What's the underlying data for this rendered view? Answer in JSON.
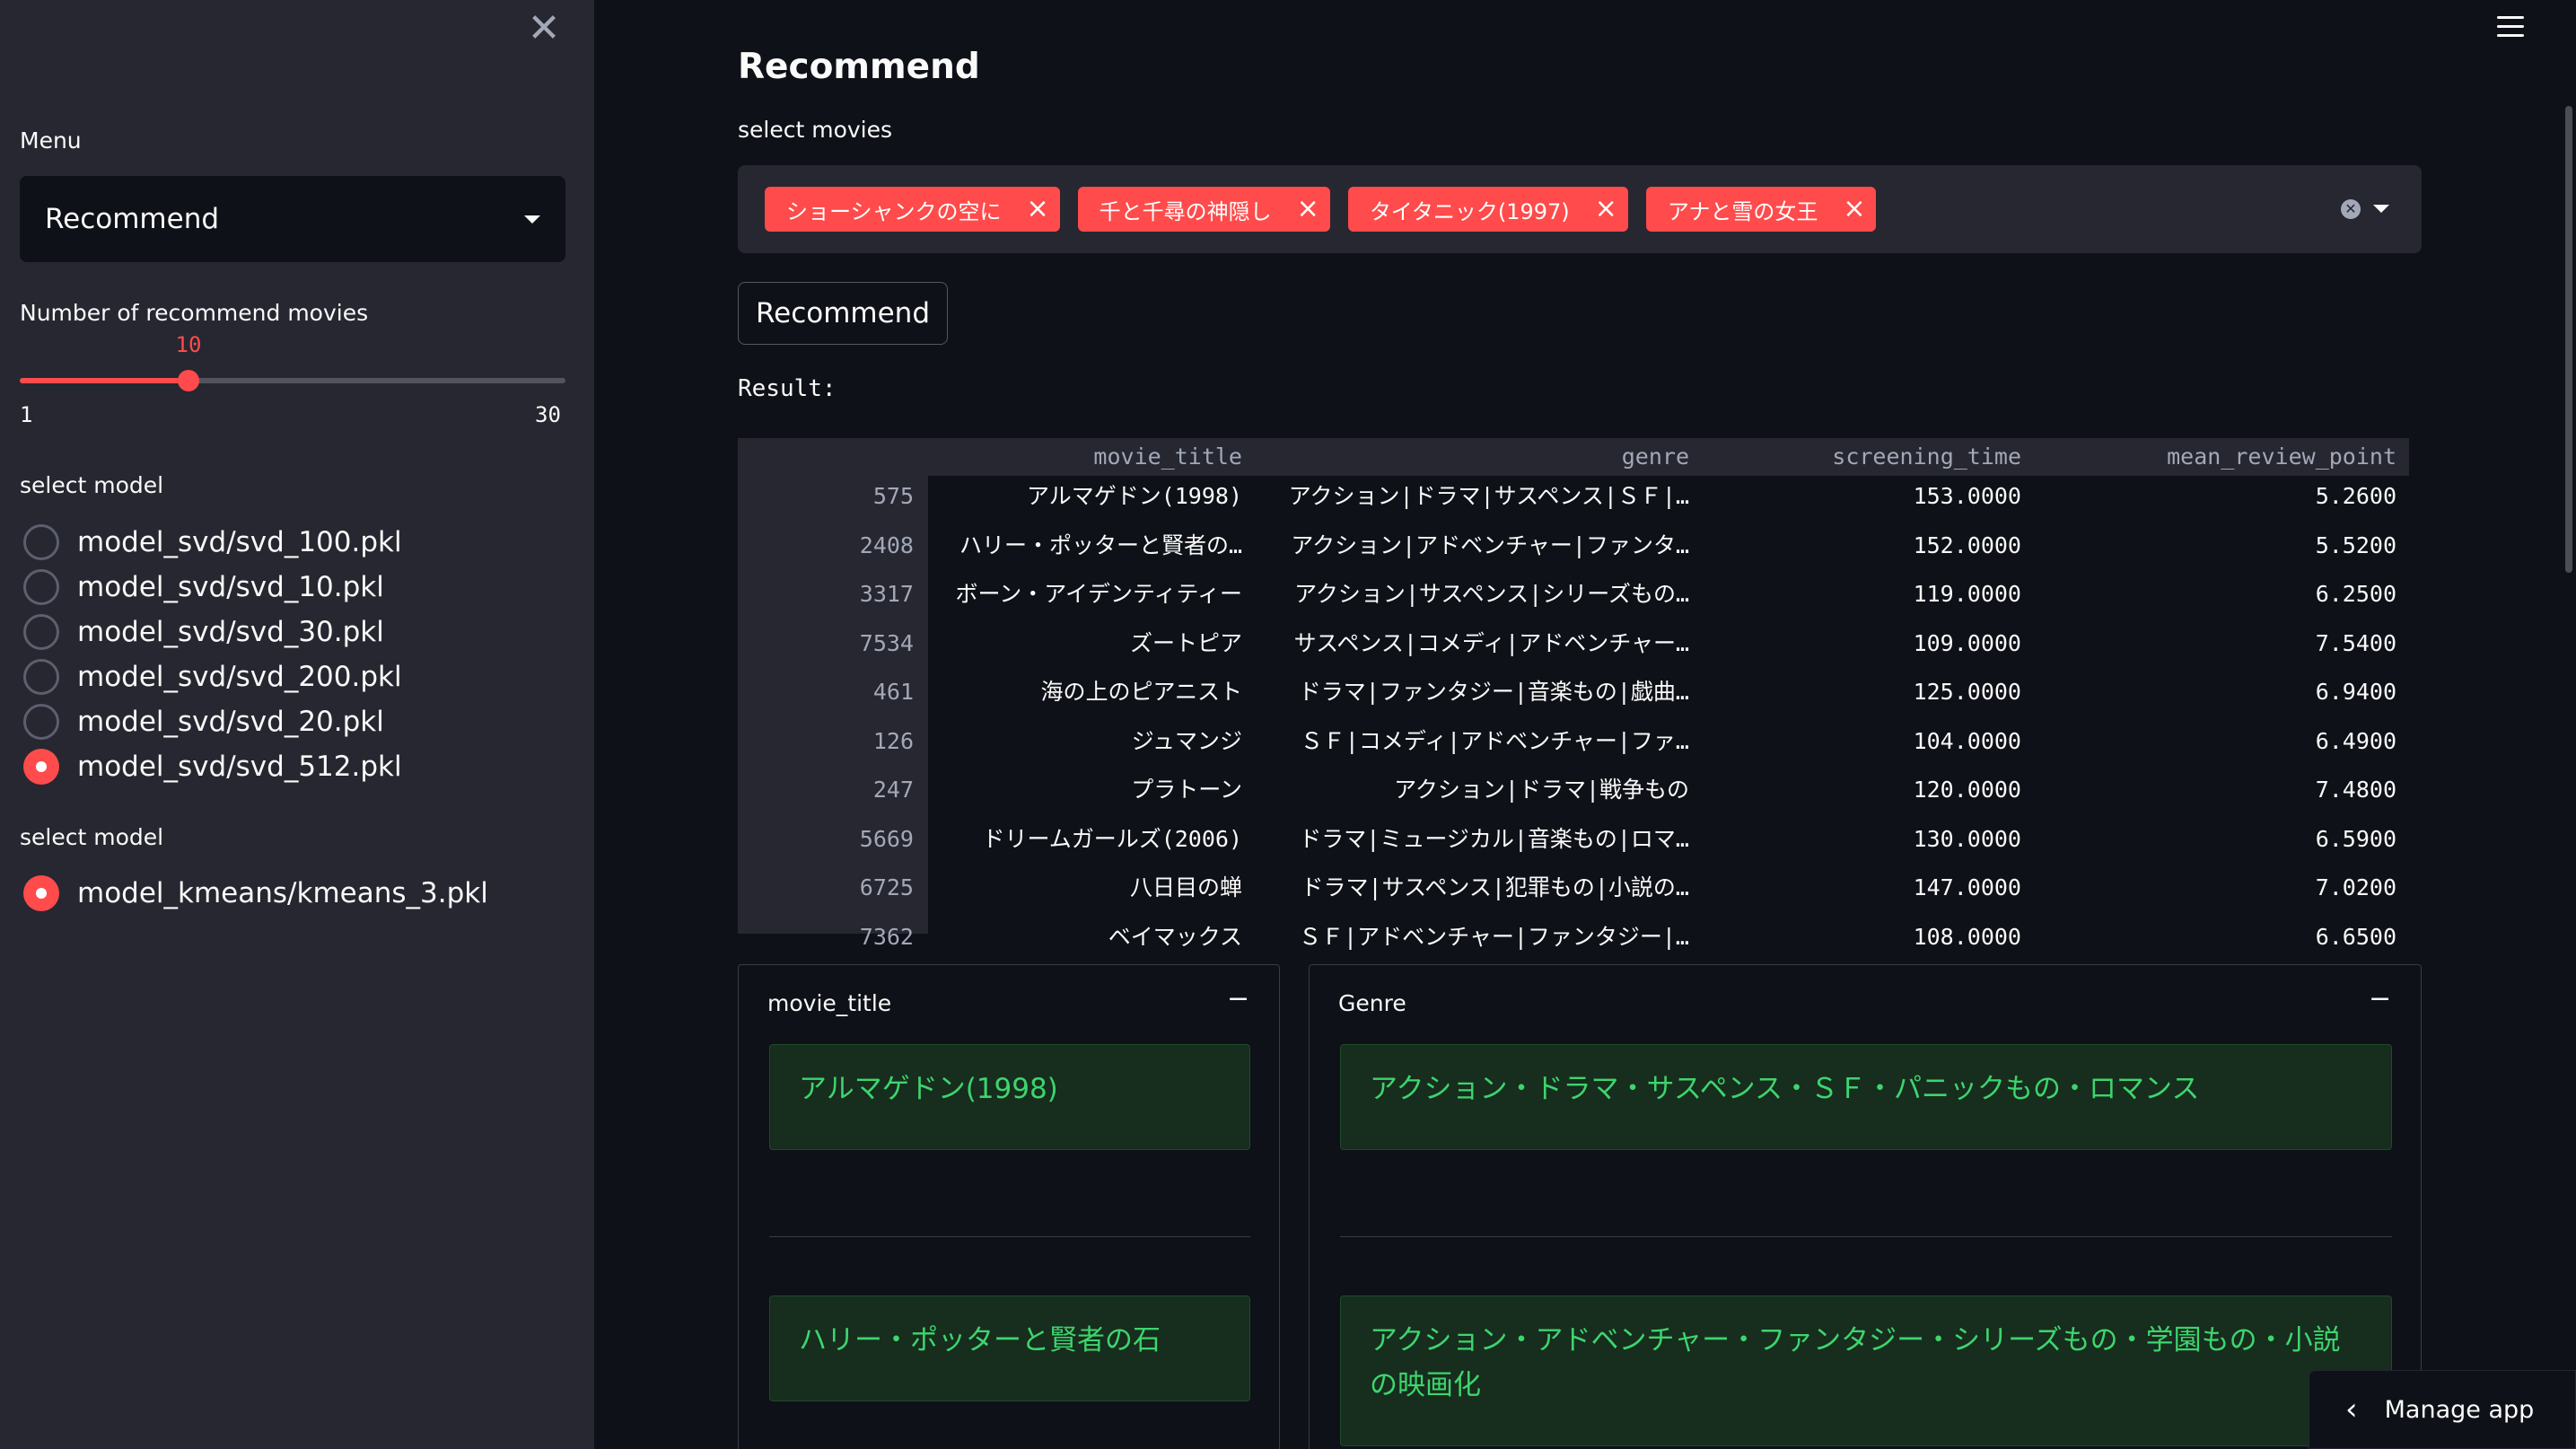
{
  "sidebar": {
    "close_icon": "close-icon",
    "menu_label": "Menu",
    "menu_value": "Recommend",
    "num_label": "Number of recommend movies",
    "slider": {
      "value": "10",
      "min": "1",
      "max": "30",
      "fraction": 0.31
    },
    "model_label_1": "select model",
    "svd_models": [
      {
        "label": "model_svd/svd_100.pkl",
        "checked": false
      },
      {
        "label": "model_svd/svd_10.pkl",
        "checked": false
      },
      {
        "label": "model_svd/svd_30.pkl",
        "checked": false
      },
      {
        "label": "model_svd/svd_200.pkl",
        "checked": false
      },
      {
        "label": "model_svd/svd_20.pkl",
        "checked": false
      },
      {
        "label": "model_svd/svd_512.pkl",
        "checked": true
      }
    ],
    "model_label_2": "select model",
    "kmeans_models": [
      {
        "label": "model_kmeans/kmeans_3.pkl",
        "checked": true
      }
    ]
  },
  "main": {
    "title": "Recommend",
    "select_label": "select movies",
    "chips": [
      "ショーシャンクの空に",
      "千と千尋の神隠し",
      "タイタニック(1997)",
      "アナと雪の女王"
    ],
    "button_label": "Recommend",
    "result_label": "Result:",
    "table": {
      "columns": [
        "movie_title",
        "genre",
        "screening_time",
        "mean_review_point"
      ],
      "rows": [
        [
          "575",
          "アルマゲドン(1998)",
          "アクション|ドラマ|サスペンス|ＳＦ|…",
          "153.0000",
          "5.2600"
        ],
        [
          "2408",
          "ハリー・ポッターと賢者の…",
          "アクション|アドベンチャー|ファンタ…",
          "152.0000",
          "5.5200"
        ],
        [
          "3317",
          "ボーン・アイデンティティー",
          "アクション|サスペンス|シリーズもの…",
          "119.0000",
          "6.2500"
        ],
        [
          "7534",
          "ズートピア",
          "サスペンス|コメディ|アドベンチャー…",
          "109.0000",
          "7.5400"
        ],
        [
          "461",
          "海の上のピアニスト",
          "ドラマ|ファンタジー|音楽もの|戯曲…",
          "125.0000",
          "6.9400"
        ],
        [
          "126",
          "ジュマンジ",
          "ＳＦ|コメディ|アドベンチャー|ファ…",
          "104.0000",
          "6.4900"
        ],
        [
          "247",
          "プラトーン",
          "アクション|ドラマ|戦争もの",
          "120.0000",
          "7.4800"
        ],
        [
          "5669",
          "ドリームガールズ(2006)",
          "ドラマ|ミュージカル|音楽もの|ロマ…",
          "130.0000",
          "6.5900"
        ],
        [
          "6725",
          "八日目の蝉",
          "ドラマ|サスペンス|犯罪もの|小説の…",
          "147.0000",
          "7.0200"
        ],
        [
          "7362",
          "ベイマックス",
          "ＳＦ|アドベンチャー|ファンタジー|…",
          "108.0000",
          "6.6500"
        ]
      ]
    },
    "card_title": {
      "title": "movie_title",
      "minimize": "−",
      "items": [
        "アルマゲドン(1998)",
        "ハリー・ポッターと賢者の石"
      ]
    },
    "card_genre": {
      "title": "Genre",
      "minimize": "−",
      "items": [
        "アクション・ドラマ・サスペンス・ＳＦ・パニックもの・ロマンス",
        "アクション・アドベンチャー・ファンタジー・シリーズもの・学園もの・小説の映画化"
      ]
    },
    "manage_app": "Manage app"
  },
  "colors": {
    "accent": "#ff4b4b",
    "background": "#0e1117",
    "sidebar": "#262730",
    "success_text": "#3dd56d"
  }
}
